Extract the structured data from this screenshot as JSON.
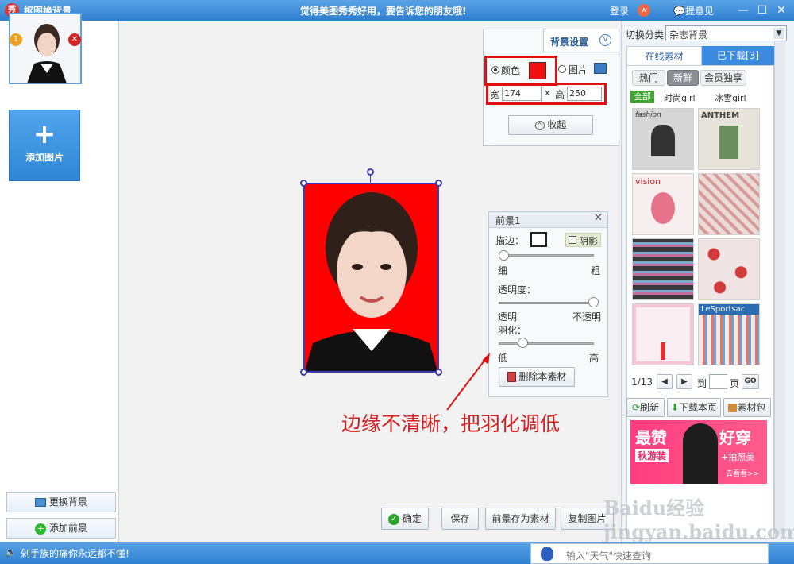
{
  "titlebar": {
    "logo_text": "秀",
    "title": "抠图换背景",
    "slogan": "觉得美图秀秀好用，要告诉您的朋友哦!",
    "login": "登录",
    "weibo_icon": "weibo-icon",
    "feedback": "提意见",
    "minimize_icon": "minimize-icon",
    "maximize_icon": "maximize-icon",
    "close_icon": "close-icon"
  },
  "left_panel": {
    "thumb_badge": "1",
    "add_picture": "添加图片",
    "change_bg": "更换背景",
    "add_fg": "添加前景"
  },
  "bg_settings": {
    "header": "背景设置",
    "color_label": "颜色",
    "image_label": "图片",
    "width_label": "宽",
    "width_value": "174",
    "times": "x",
    "height_label": "高",
    "height_value": "250",
    "collapse": "收起",
    "color_swatch": "#ee1111"
  },
  "fg_panel": {
    "title": "前景1",
    "stroke_label": "描边：",
    "shadow_label": "阴影",
    "thin": "细",
    "thick": "粗",
    "opacity_label": "透明度：",
    "transparent": "透明",
    "opaque": "不透明",
    "feather_label": "羽化：",
    "low": "低",
    "high": "高",
    "delete_material": "删除本素材",
    "stroke_level": 0.05,
    "opacity_level": 0.99,
    "feather_level": 0.25
  },
  "annotation": "边缘不清晰，把羽化调低",
  "bottom_buttons": {
    "confirm": "确定",
    "save": "保存",
    "save_fg": "前景存为素材",
    "copy": "复制图片"
  },
  "right_panel": {
    "switch_label": "切换分类",
    "category": "杂志背景",
    "tab_online": "在线素材",
    "tab_downloaded": "已下载[3]",
    "sub_tabs": [
      "热门",
      "新鲜",
      "会员独享"
    ],
    "filters": [
      "全部",
      "时尚girl",
      "冰雪girl"
    ],
    "tiles": [
      {
        "label": "fashion",
        "color": "#d6d6d6"
      },
      {
        "label": "ANTHEM",
        "color": "#e8e4dc"
      },
      {
        "label": "vision",
        "color": "#f7eef0"
      },
      {
        "label": "",
        "color": "#eadbd6"
      },
      {
        "label": "",
        "color": "#3a3a3a"
      },
      {
        "label": "",
        "color": "#f0e4e4"
      },
      {
        "label": "",
        "color": "#fbeef3"
      },
      {
        "label": "LeSportsac",
        "color": "#f3ebe3"
      }
    ],
    "pager_text": "1/13",
    "goto_label": "到",
    "page_label": "页",
    "go": "GO",
    "refresh": "刷新",
    "download_page": "下载本页",
    "material_pack": "素材包",
    "ad_text_1": "最赞",
    "ad_text_2": "秋游装",
    "ad_text_3": "好穿",
    "ad_text_4": "+拍照美",
    "ad_text_5": "去看看>>"
  },
  "statusbar": {
    "volume_icon": "speaker-icon",
    "ticker": "剁手族的痛你永远都不懂!",
    "search_placeholder": "输入\"天气\"快速查询"
  },
  "watermark": "Baidu经验 jingyan.baidu.com"
}
